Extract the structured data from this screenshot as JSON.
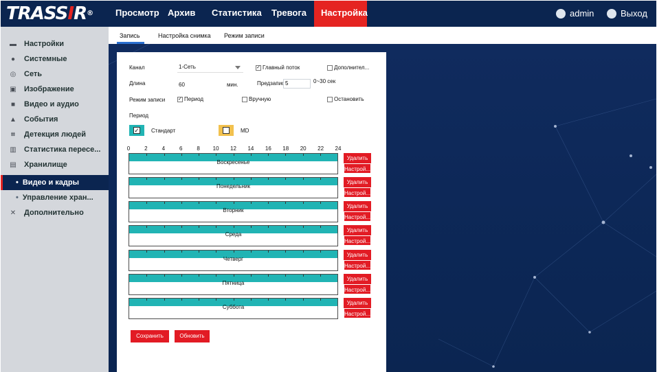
{
  "app": {
    "logo_text": "TRASSIR",
    "colors": {
      "brand_red": "#e52421",
      "navy": "#0b2550",
      "teal": "#21b4b4"
    }
  },
  "topnav": {
    "items": [
      "Просмотр",
      "Архив",
      "Статистика",
      "Тревога",
      "Настройка"
    ],
    "active": "Настройка",
    "user": "admin",
    "logout": "Выход"
  },
  "sidebar": {
    "items": [
      {
        "label": "Настройки",
        "icon": "monitor-icon"
      },
      {
        "label": "Системные",
        "icon": "info-icon"
      },
      {
        "label": "Сеть",
        "icon": "globe-icon"
      },
      {
        "label": "Изображение",
        "icon": "image-icon"
      },
      {
        "label": "Видео и аудио",
        "icon": "video-icon"
      },
      {
        "label": "События",
        "icon": "bell-icon"
      },
      {
        "label": "Детекция людей",
        "icon": "person-detect-icon"
      },
      {
        "label": "Статистика пересе...",
        "icon": "chart-icon"
      },
      {
        "label": "Хранилище",
        "icon": "storage-icon"
      },
      {
        "label": "Видео и кадры",
        "sub": true,
        "active": true
      },
      {
        "label": "Управление хран...",
        "sub": true
      },
      {
        "label": "Дополнительно",
        "icon": "tools-icon"
      }
    ]
  },
  "subtabs": [
    "Запись",
    "Настройка снимка",
    "Режим записи"
  ],
  "form": {
    "channel_label": "Канал",
    "channel_value": "1-Сеть",
    "main_stream": "Главный поток",
    "extra_stream": "Дополнител...",
    "length_label": "Длина",
    "length_value": "60",
    "length_unit": "мин.",
    "prerecord_label": "Предзапись",
    "prerecord_value": "5",
    "prerecord_hint": "0~30 сек",
    "mode_label": "Режим записи",
    "mode_period": "Период",
    "mode_manual": "Вручную",
    "mode_stop": "Остановить",
    "period_label": "Период",
    "legend_standard": "Стандарт",
    "legend_md": "MD",
    "legend_colors": {
      "standard": "#21b4b4",
      "md": "#f2c14e"
    }
  },
  "timeline": {
    "hours": [
      "0",
      "2",
      "4",
      "6",
      "8",
      "10",
      "12",
      "14",
      "16",
      "18",
      "20",
      "22",
      "24"
    ],
    "days": [
      "Воскресенье",
      "Понедельник",
      "Вторник",
      "Среда",
      "Четверг",
      "Пятница",
      "Суббота"
    ],
    "delete_label": "Удалить",
    "config_label": "Настрой..."
  },
  "actions": {
    "save": "Сохранить",
    "refresh": "Обновить"
  }
}
